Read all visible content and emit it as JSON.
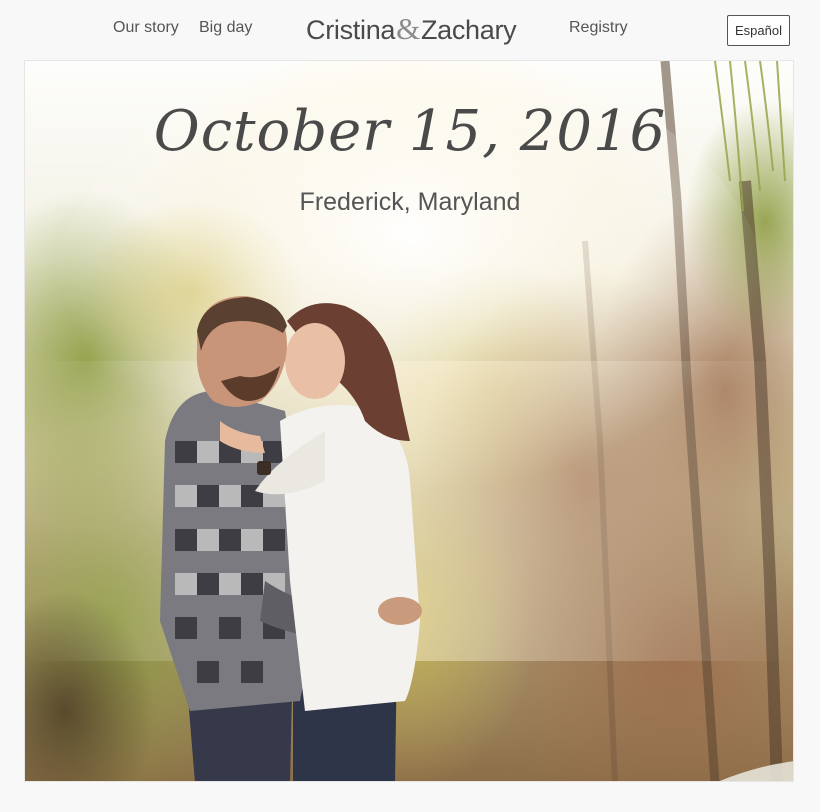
{
  "nav": {
    "our_story": "Our story",
    "big_day": "Big day",
    "registry": "Registry",
    "brand_first": "Cristina",
    "brand_amp": "&",
    "brand_second": "Zachary",
    "language_button": "Español"
  },
  "hero": {
    "date": "October 15, 2016",
    "location": "Frederick, Maryland",
    "photo_subject": "couple-embracing-in-autumn-woods"
  },
  "colors": {
    "page_background": "#f8f8f8",
    "text": "#555555",
    "brand_text": "#4a4a4a",
    "accent_ampersand": "#8c8c8c"
  }
}
